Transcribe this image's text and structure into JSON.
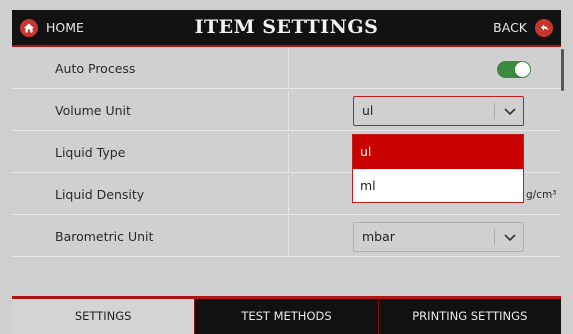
{
  "header": {
    "home_label": "HOME",
    "title": "ITEM SETTINGS",
    "back_label": "BACK"
  },
  "rows": [
    {
      "label": "Auto Process",
      "control": "toggle",
      "toggle_on": true
    },
    {
      "label": "Volume Unit",
      "control": "select",
      "value": "ul"
    },
    {
      "label": "Liquid Type"
    },
    {
      "label": "Liquid Density",
      "unit": "g/cm³"
    },
    {
      "label": "Barometric Unit",
      "control": "select",
      "value": "mbar"
    }
  ],
  "dropdown": {
    "options": [
      "ul",
      "ml"
    ],
    "selected": "ul"
  },
  "tabs": [
    {
      "label": "SETTINGS",
      "active": true
    },
    {
      "label": "TEST METHODS",
      "active": false
    },
    {
      "label": "PRINTING SETTINGS",
      "active": false
    }
  ],
  "colors": {
    "accent": "#c80000",
    "toggle_on": "#3b8a3f",
    "header_bg": "#121212"
  },
  "icons": {
    "home": "home-icon",
    "back": "back-arrow-icon",
    "dropdown": "chevron-down-icon"
  }
}
